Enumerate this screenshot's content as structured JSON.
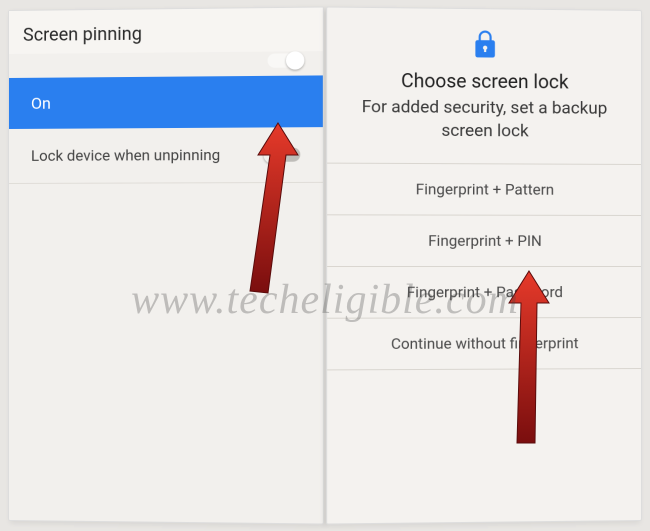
{
  "left_screen": {
    "title": "Screen pinning",
    "state_label": "On",
    "setting_label": "Lock device when unpinning"
  },
  "right_screen": {
    "title": "Choose screen lock",
    "subtitle": "For added security, set a backup screen lock",
    "options": {
      "opt1": "Fingerprint + Pattern",
      "opt2": "Fingerprint + PIN",
      "opt3": "Fingerprint + Password",
      "opt4": "Continue without fingerprint"
    }
  },
  "watermark": "www.techeligible.com"
}
